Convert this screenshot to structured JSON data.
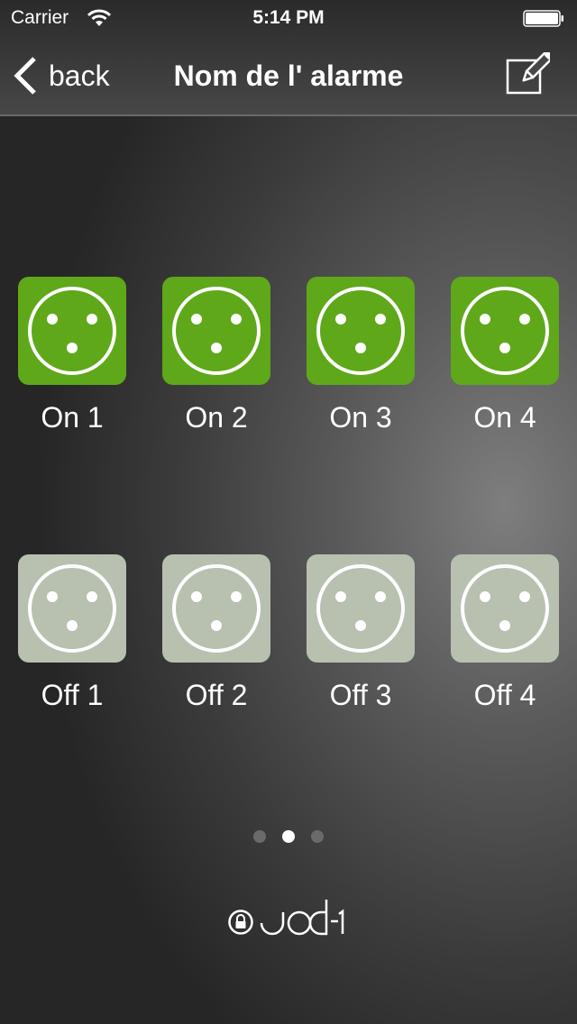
{
  "status_bar": {
    "carrier": "Carrier",
    "time": "5:14 PM",
    "wifi_icon": "wifi-icon",
    "battery_icon": "battery-full-icon"
  },
  "nav": {
    "back_label": "back",
    "back_icon": "chevron-left-icon",
    "title": "Nom de l' alarme",
    "edit_icon": "edit-pencil-icon"
  },
  "colors": {
    "on": "#5ea81a",
    "off": "#b8c0b0"
  },
  "on_switches": [
    {
      "label": "On 1",
      "state": "on",
      "icon": "power-outlet-icon"
    },
    {
      "label": "On 2",
      "state": "on",
      "icon": "power-outlet-icon"
    },
    {
      "label": "On 3",
      "state": "on",
      "icon": "power-outlet-icon"
    },
    {
      "label": "On 4",
      "state": "on",
      "icon": "power-outlet-icon"
    }
  ],
  "off_switches": [
    {
      "label": "Off 1",
      "state": "off",
      "icon": "power-outlet-icon"
    },
    {
      "label": "Off 2",
      "state": "off",
      "icon": "power-outlet-icon"
    },
    {
      "label": "Off 3",
      "state": "off",
      "icon": "power-outlet-icon"
    },
    {
      "label": "Off 4",
      "state": "off",
      "icon": "power-outlet-icon"
    }
  ],
  "pager": {
    "pages": 3,
    "current": 2
  },
  "brand": {
    "name": "JOD-1",
    "icon": "lock-icon"
  }
}
